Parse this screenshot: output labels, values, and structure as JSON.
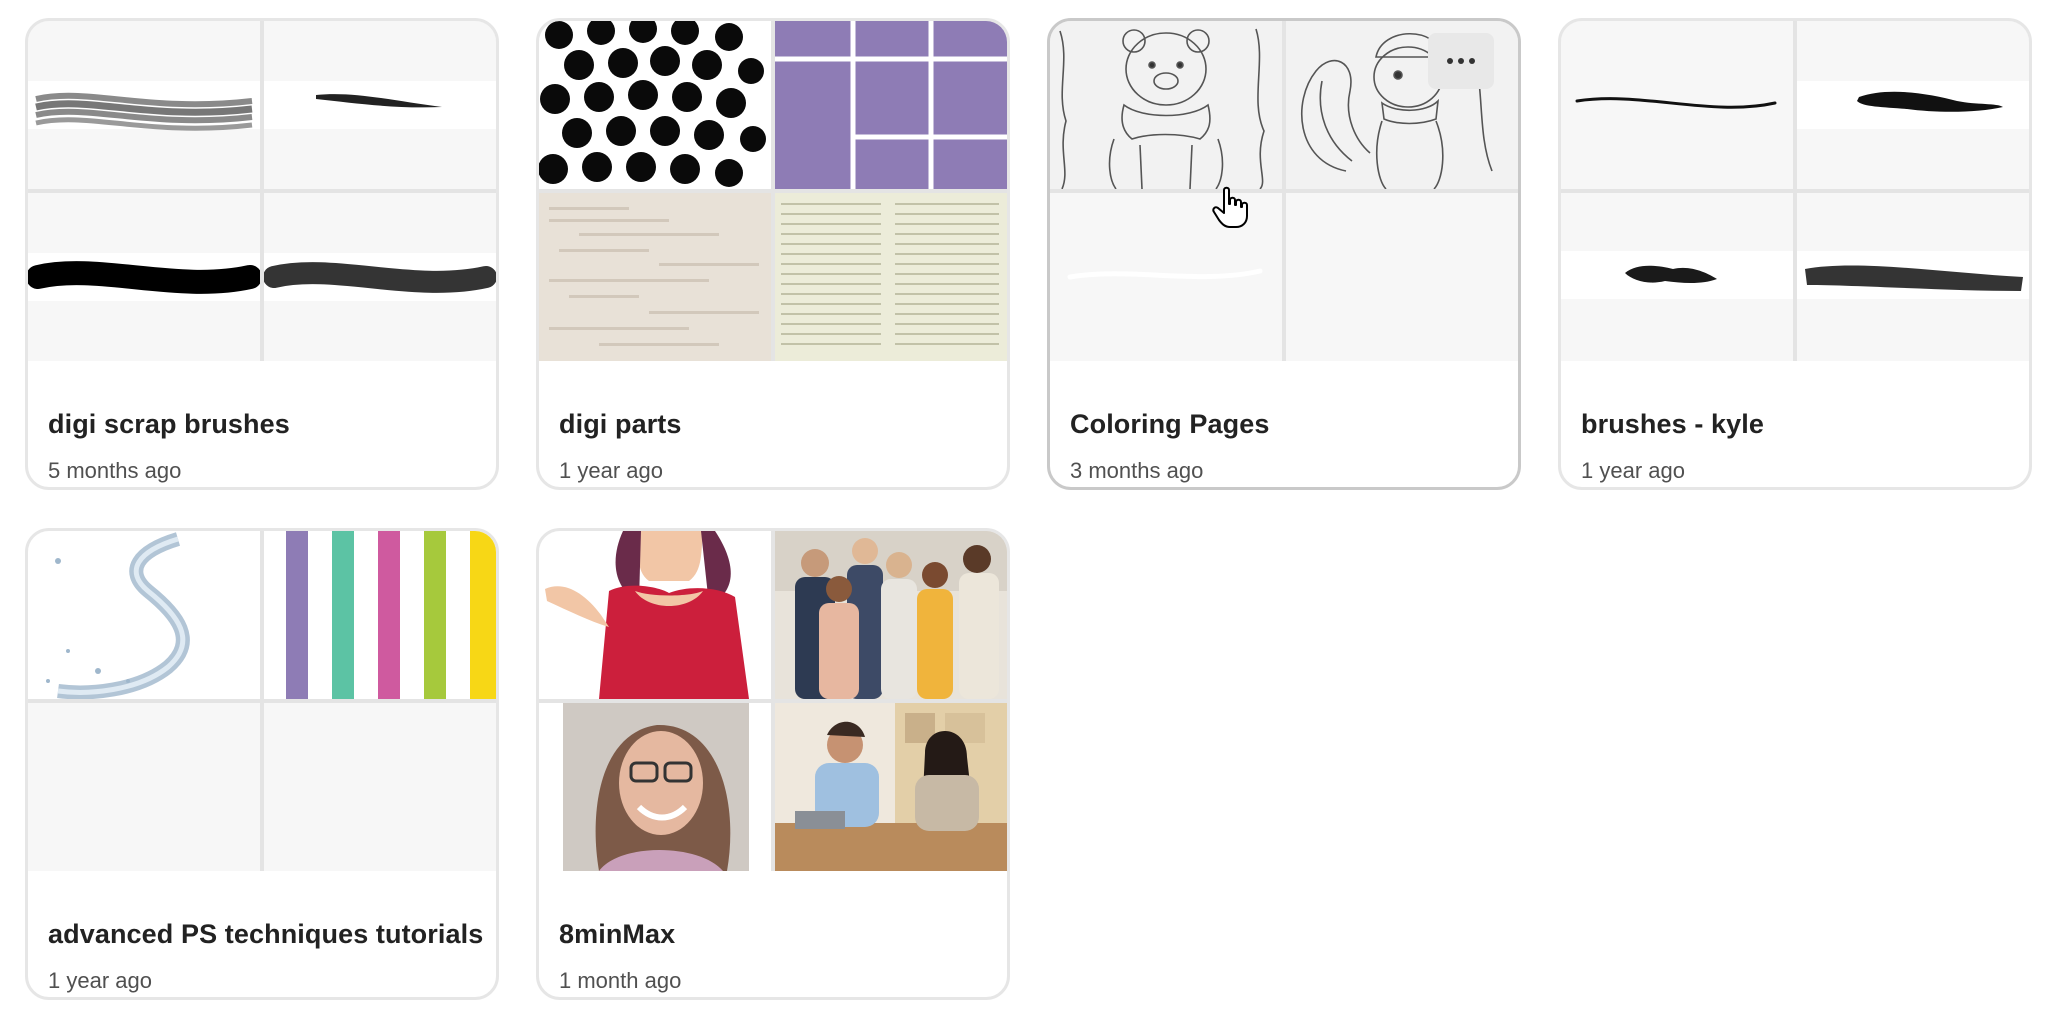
{
  "collections": [
    {
      "title": "digi scrap brushes",
      "subtitle": "5 months ago"
    },
    {
      "title": "digi parts",
      "subtitle": "1 year ago"
    },
    {
      "title": "Coloring Pages",
      "subtitle": "3 months ago"
    },
    {
      "title": "brushes - kyle",
      "subtitle": "1 year ago"
    },
    {
      "title": "advanced PS techniques tutorials",
      "subtitle": "1 year ago"
    },
    {
      "title": "8minMax",
      "subtitle": "1 month ago"
    }
  ],
  "icons": {
    "more": "more-horizontal-icon",
    "cursor": "hand-pointer-cursor-icon"
  },
  "colors": {
    "purple": "#8e7cb5",
    "card_border": "#e6e6e6",
    "title_text": "#222222",
    "subtitle_text": "#505050"
  }
}
